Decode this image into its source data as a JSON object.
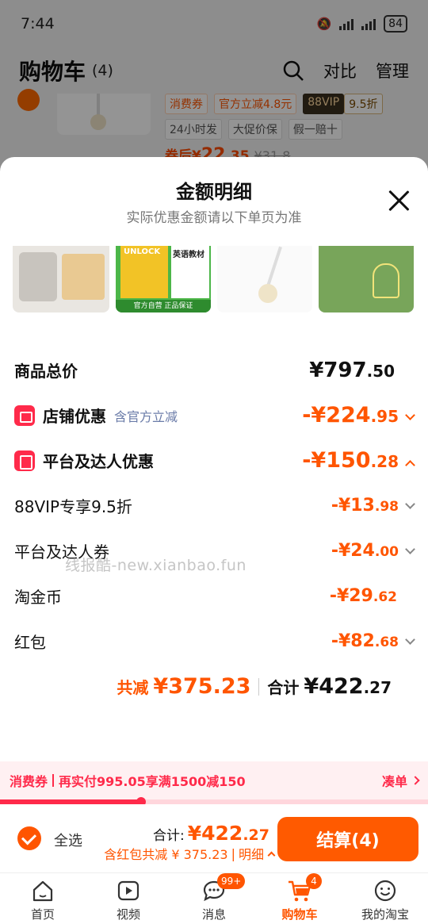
{
  "status_bar": {
    "time": "7:44",
    "battery": "84"
  },
  "cart_header": {
    "title": "购物车",
    "count": "(4)",
    "compare_label": "对比",
    "manage_label": "管理"
  },
  "bg_item": {
    "tags": [
      "消费券",
      "官方立减4.8元",
      "88VIP",
      "9.5折",
      "24小时发",
      "大促价保",
      "假一赔十"
    ],
    "price_prefix": "券后",
    "price_symbol": "¥",
    "price_int": "22",
    "price_dec": ".35",
    "original_price": "¥31.8"
  },
  "sheet": {
    "title": "金额明细",
    "subtitle": "实际优惠金额请以下单页为准",
    "thumb_texts": {
      "book_title": "UNLOCK",
      "book_side": "英语教材",
      "book_foot": "官方自营 正品保证"
    },
    "rows": [
      {
        "label": "商品总价",
        "value_int": "¥797",
        "value_dec": ".50"
      },
      {
        "label": "店铺优惠",
        "note": "含官方立减",
        "value_int": "-¥224",
        "value_dec": ".95"
      },
      {
        "label": "平台及达人优惠",
        "value_int": "-¥150",
        "value_dec": ".28"
      },
      {
        "label": "88VIP专享9.5折",
        "value_int": "-¥13",
        "value_dec": ".98"
      },
      {
        "label": "平台及达人券",
        "value_int": "-¥24",
        "value_dec": ".00"
      },
      {
        "label": "淘金币",
        "value_int": "-¥29",
        "value_dec": ".62"
      },
      {
        "label": "红包",
        "value_int": "-¥82",
        "value_dec": ".68"
      }
    ],
    "summary": {
      "discount_label": "共减",
      "discount_value": "¥375.23",
      "total_label": "合计",
      "total_int": "¥422",
      "total_dec": ".27"
    },
    "watermark": "线报酷-new.xianbao.fun"
  },
  "coupon_bar": {
    "tag": "消费券",
    "text": "再实付995.05享满1500减150",
    "link": "凑单",
    "progress_fraction": 0.33
  },
  "checkout": {
    "select_all_label": "全选",
    "total_label": "合计:",
    "total_int": "¥422",
    "total_dec": ".27",
    "detail_text": "含红包共减 ¥ 375.23",
    "detail_link": "明细",
    "pay_label": "结算(4)"
  },
  "tabbar": {
    "tabs": [
      {
        "label": "首页",
        "icon": "home-icon"
      },
      {
        "label": "视频",
        "icon": "video-icon"
      },
      {
        "label": "消息",
        "icon": "message-icon",
        "badge": "99+"
      },
      {
        "label": "购物车",
        "icon": "cart-icon",
        "badge": "4"
      },
      {
        "label": "我的淘宝",
        "icon": "profile-icon"
      }
    ]
  },
  "colors": {
    "accent": "#ff5500",
    "coupon_red": "#ff2a4a"
  }
}
